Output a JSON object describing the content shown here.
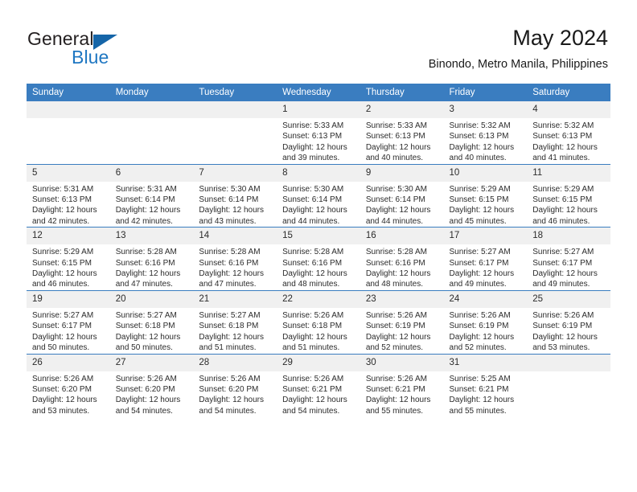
{
  "brand": {
    "name_part1": "General",
    "name_part2": "Blue"
  },
  "header": {
    "title": "May 2024",
    "subtitle": "Binondo, Metro Manila, Philippines"
  },
  "calendar": {
    "weekday_headers": [
      "Sunday",
      "Monday",
      "Tuesday",
      "Wednesday",
      "Thursday",
      "Friday",
      "Saturday"
    ],
    "accent_color": "#3a7dc0",
    "daynum_background": "#f0f0f0",
    "weeks": [
      [
        {
          "day": "",
          "lines": []
        },
        {
          "day": "",
          "lines": []
        },
        {
          "day": "",
          "lines": []
        },
        {
          "day": "1",
          "lines": [
            "Sunrise: 5:33 AM",
            "Sunset: 6:13 PM",
            "Daylight: 12 hours",
            "and 39 minutes."
          ]
        },
        {
          "day": "2",
          "lines": [
            "Sunrise: 5:33 AM",
            "Sunset: 6:13 PM",
            "Daylight: 12 hours",
            "and 40 minutes."
          ]
        },
        {
          "day": "3",
          "lines": [
            "Sunrise: 5:32 AM",
            "Sunset: 6:13 PM",
            "Daylight: 12 hours",
            "and 40 minutes."
          ]
        },
        {
          "day": "4",
          "lines": [
            "Sunrise: 5:32 AM",
            "Sunset: 6:13 PM",
            "Daylight: 12 hours",
            "and 41 minutes."
          ]
        }
      ],
      [
        {
          "day": "5",
          "lines": [
            "Sunrise: 5:31 AM",
            "Sunset: 6:13 PM",
            "Daylight: 12 hours",
            "and 42 minutes."
          ]
        },
        {
          "day": "6",
          "lines": [
            "Sunrise: 5:31 AM",
            "Sunset: 6:14 PM",
            "Daylight: 12 hours",
            "and 42 minutes."
          ]
        },
        {
          "day": "7",
          "lines": [
            "Sunrise: 5:30 AM",
            "Sunset: 6:14 PM",
            "Daylight: 12 hours",
            "and 43 minutes."
          ]
        },
        {
          "day": "8",
          "lines": [
            "Sunrise: 5:30 AM",
            "Sunset: 6:14 PM",
            "Daylight: 12 hours",
            "and 44 minutes."
          ]
        },
        {
          "day": "9",
          "lines": [
            "Sunrise: 5:30 AM",
            "Sunset: 6:14 PM",
            "Daylight: 12 hours",
            "and 44 minutes."
          ]
        },
        {
          "day": "10",
          "lines": [
            "Sunrise: 5:29 AM",
            "Sunset: 6:15 PM",
            "Daylight: 12 hours",
            "and 45 minutes."
          ]
        },
        {
          "day": "11",
          "lines": [
            "Sunrise: 5:29 AM",
            "Sunset: 6:15 PM",
            "Daylight: 12 hours",
            "and 46 minutes."
          ]
        }
      ],
      [
        {
          "day": "12",
          "lines": [
            "Sunrise: 5:29 AM",
            "Sunset: 6:15 PM",
            "Daylight: 12 hours",
            "and 46 minutes."
          ]
        },
        {
          "day": "13",
          "lines": [
            "Sunrise: 5:28 AM",
            "Sunset: 6:16 PM",
            "Daylight: 12 hours",
            "and 47 minutes."
          ]
        },
        {
          "day": "14",
          "lines": [
            "Sunrise: 5:28 AM",
            "Sunset: 6:16 PM",
            "Daylight: 12 hours",
            "and 47 minutes."
          ]
        },
        {
          "day": "15",
          "lines": [
            "Sunrise: 5:28 AM",
            "Sunset: 6:16 PM",
            "Daylight: 12 hours",
            "and 48 minutes."
          ]
        },
        {
          "day": "16",
          "lines": [
            "Sunrise: 5:28 AM",
            "Sunset: 6:16 PM",
            "Daylight: 12 hours",
            "and 48 minutes."
          ]
        },
        {
          "day": "17",
          "lines": [
            "Sunrise: 5:27 AM",
            "Sunset: 6:17 PM",
            "Daylight: 12 hours",
            "and 49 minutes."
          ]
        },
        {
          "day": "18",
          "lines": [
            "Sunrise: 5:27 AM",
            "Sunset: 6:17 PM",
            "Daylight: 12 hours",
            "and 49 minutes."
          ]
        }
      ],
      [
        {
          "day": "19",
          "lines": [
            "Sunrise: 5:27 AM",
            "Sunset: 6:17 PM",
            "Daylight: 12 hours",
            "and 50 minutes."
          ]
        },
        {
          "day": "20",
          "lines": [
            "Sunrise: 5:27 AM",
            "Sunset: 6:18 PM",
            "Daylight: 12 hours",
            "and 50 minutes."
          ]
        },
        {
          "day": "21",
          "lines": [
            "Sunrise: 5:27 AM",
            "Sunset: 6:18 PM",
            "Daylight: 12 hours",
            "and 51 minutes."
          ]
        },
        {
          "day": "22",
          "lines": [
            "Sunrise: 5:26 AM",
            "Sunset: 6:18 PM",
            "Daylight: 12 hours",
            "and 51 minutes."
          ]
        },
        {
          "day": "23",
          "lines": [
            "Sunrise: 5:26 AM",
            "Sunset: 6:19 PM",
            "Daylight: 12 hours",
            "and 52 minutes."
          ]
        },
        {
          "day": "24",
          "lines": [
            "Sunrise: 5:26 AM",
            "Sunset: 6:19 PM",
            "Daylight: 12 hours",
            "and 52 minutes."
          ]
        },
        {
          "day": "25",
          "lines": [
            "Sunrise: 5:26 AM",
            "Sunset: 6:19 PM",
            "Daylight: 12 hours",
            "and 53 minutes."
          ]
        }
      ],
      [
        {
          "day": "26",
          "lines": [
            "Sunrise: 5:26 AM",
            "Sunset: 6:20 PM",
            "Daylight: 12 hours",
            "and 53 minutes."
          ]
        },
        {
          "day": "27",
          "lines": [
            "Sunrise: 5:26 AM",
            "Sunset: 6:20 PM",
            "Daylight: 12 hours",
            "and 54 minutes."
          ]
        },
        {
          "day": "28",
          "lines": [
            "Sunrise: 5:26 AM",
            "Sunset: 6:20 PM",
            "Daylight: 12 hours",
            "and 54 minutes."
          ]
        },
        {
          "day": "29",
          "lines": [
            "Sunrise: 5:26 AM",
            "Sunset: 6:21 PM",
            "Daylight: 12 hours",
            "and 54 minutes."
          ]
        },
        {
          "day": "30",
          "lines": [
            "Sunrise: 5:26 AM",
            "Sunset: 6:21 PM",
            "Daylight: 12 hours",
            "and 55 minutes."
          ]
        },
        {
          "day": "31",
          "lines": [
            "Sunrise: 5:25 AM",
            "Sunset: 6:21 PM",
            "Daylight: 12 hours",
            "and 55 minutes."
          ]
        },
        {
          "day": "",
          "lines": []
        }
      ]
    ]
  }
}
